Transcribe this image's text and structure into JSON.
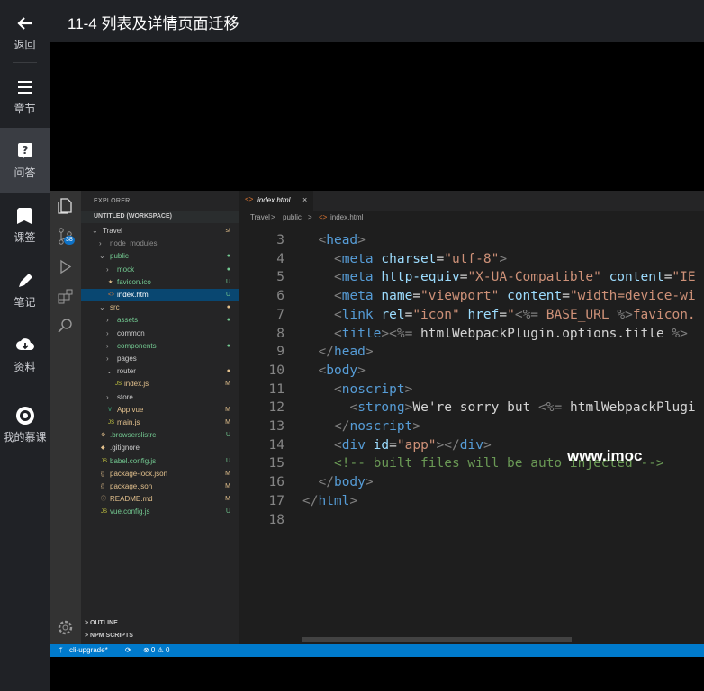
{
  "nav": {
    "back": "返回",
    "chapters": "章节",
    "qa": "问答",
    "bookmarks": "课签",
    "notes": "笔记",
    "materials": "资料",
    "my_courses": "我的慕课"
  },
  "header": {
    "title": "11-4 列表及详情页面迁移"
  },
  "vscode": {
    "activity_badge": "38",
    "explorer_title": "EXPLORER",
    "workspace": "UNTITLED (WORKSPACE)",
    "tree": [
      {
        "label": "Travel",
        "status": "st",
        "indent": 1,
        "arrow": "v",
        "icon": "",
        "color": "#cccccc",
        "status_color": "#e2c08d"
      },
      {
        "label": "node_modules",
        "status": "",
        "indent": 2,
        "arrow": ">",
        "icon": "",
        "color": "#8b8b8b",
        "status_color": ""
      },
      {
        "label": "public",
        "status": "●",
        "indent": 2,
        "arrow": "v",
        "icon": "",
        "color": "#73c991",
        "status_color": "#73c991"
      },
      {
        "label": "mock",
        "status": "●",
        "indent": 3,
        "arrow": ">",
        "icon": "",
        "color": "#73c991",
        "status_color": "#73c991"
      },
      {
        "label": "favicon.ico",
        "status": "U",
        "indent": 3,
        "arrow": "",
        "icon": "★",
        "color": "#73c991",
        "status_color": "#73c991"
      },
      {
        "label": "index.html",
        "status": "U",
        "indent": 3,
        "arrow": "",
        "icon": "<>",
        "color": "#ffffff",
        "status_color": "#73c991",
        "selected": true
      },
      {
        "label": "src",
        "status": "●",
        "indent": 2,
        "arrow": "v",
        "icon": "",
        "color": "#e2c08d",
        "status_color": "#e2c08d"
      },
      {
        "label": "assets",
        "status": "●",
        "indent": 3,
        "arrow": ">",
        "icon": "",
        "color": "#73c991",
        "status_color": "#73c991"
      },
      {
        "label": "common",
        "status": "",
        "indent": 3,
        "arrow": ">",
        "icon": "",
        "color": "#cccccc",
        "status_color": ""
      },
      {
        "label": "components",
        "status": "●",
        "indent": 3,
        "arrow": ">",
        "icon": "",
        "color": "#73c991",
        "status_color": "#73c991"
      },
      {
        "label": "pages",
        "status": "",
        "indent": 3,
        "arrow": ">",
        "icon": "",
        "color": "#cccccc",
        "status_color": ""
      },
      {
        "label": "router",
        "status": "●",
        "indent": 3,
        "arrow": "v",
        "icon": "",
        "color": "#cccccc",
        "status_color": "#e2c08d"
      },
      {
        "label": "index.js",
        "status": "M",
        "indent": 4,
        "arrow": "",
        "icon": "JS",
        "color": "#e2c08d",
        "status_color": "#e2c08d"
      },
      {
        "label": "store",
        "status": "",
        "indent": 3,
        "arrow": ">",
        "icon": "",
        "color": "#cccccc",
        "status_color": ""
      },
      {
        "label": "App.vue",
        "status": "M",
        "indent": 3,
        "arrow": "",
        "icon": "V",
        "color": "#e2c08d",
        "status_color": "#e2c08d"
      },
      {
        "label": "main.js",
        "status": "M",
        "indent": 3,
        "arrow": "",
        "icon": "JS",
        "color": "#e2c08d",
        "status_color": "#e2c08d"
      },
      {
        "label": ".browserslistrc",
        "status": "U",
        "indent": 2,
        "arrow": "",
        "icon": "⚙",
        "color": "#73c991",
        "status_color": "#73c991"
      },
      {
        "label": ".gitignore",
        "status": "",
        "indent": 2,
        "arrow": "",
        "icon": "◆",
        "color": "#cccccc",
        "status_color": ""
      },
      {
        "label": "babel.config.js",
        "status": "U",
        "indent": 2,
        "arrow": "",
        "icon": "JS",
        "color": "#73c991",
        "status_color": "#73c991"
      },
      {
        "label": "package-lock.json",
        "status": "M",
        "indent": 2,
        "arrow": "",
        "icon": "{}",
        "color": "#e2c08d",
        "status_color": "#e2c08d"
      },
      {
        "label": "package.json",
        "status": "M",
        "indent": 2,
        "arrow": "",
        "icon": "{}",
        "color": "#e2c08d",
        "status_color": "#e2c08d"
      },
      {
        "label": "README.md",
        "status": "M",
        "indent": 2,
        "arrow": "",
        "icon": "ⓘ",
        "color": "#e2c08d",
        "status_color": "#e2c08d"
      },
      {
        "label": "vue.config.js",
        "status": "U",
        "indent": 2,
        "arrow": "",
        "icon": "JS",
        "color": "#73c991",
        "status_color": "#73c991"
      }
    ],
    "outline": "OUTLINE",
    "npm_scripts": "NPM SCRIPTS",
    "tab_label": "index.html",
    "tab_close": "×",
    "breadcrumb": [
      "Travel",
      "public",
      "index.html"
    ],
    "code_lines": [
      {
        "n": "3",
        "indent": 1,
        "tokens": [
          [
            "b",
            "<"
          ],
          [
            "tag",
            "head"
          ],
          [
            "b",
            ">"
          ]
        ]
      },
      {
        "n": "4",
        "indent": 2,
        "tokens": [
          [
            "b",
            "<"
          ],
          [
            "tag",
            "meta"
          ],
          [
            "tx",
            " "
          ],
          [
            "attr",
            "charset"
          ],
          [
            "tx",
            "="
          ],
          [
            "str",
            "\"utf-8\""
          ],
          [
            "b",
            ">"
          ]
        ]
      },
      {
        "n": "5",
        "indent": 2,
        "tokens": [
          [
            "b",
            "<"
          ],
          [
            "tag",
            "meta"
          ],
          [
            "tx",
            " "
          ],
          [
            "attr",
            "http-equiv"
          ],
          [
            "tx",
            "="
          ],
          [
            "str",
            "\"X-UA-Compatible\""
          ],
          [
            "tx",
            " "
          ],
          [
            "attr",
            "content"
          ],
          [
            "tx",
            "="
          ],
          [
            "str",
            "\"IE"
          ]
        ]
      },
      {
        "n": "6",
        "indent": 2,
        "tokens": [
          [
            "b",
            "<"
          ],
          [
            "tag",
            "meta"
          ],
          [
            "tx",
            " "
          ],
          [
            "attr",
            "name"
          ],
          [
            "tx",
            "="
          ],
          [
            "str",
            "\"viewport\""
          ],
          [
            "tx",
            " "
          ],
          [
            "attr",
            "content"
          ],
          [
            "tx",
            "="
          ],
          [
            "str",
            "\"width=device-wi"
          ]
        ]
      },
      {
        "n": "7",
        "indent": 2,
        "tokens": [
          [
            "b",
            "<"
          ],
          [
            "tag",
            "link"
          ],
          [
            "tx",
            " "
          ],
          [
            "attr",
            "rel"
          ],
          [
            "tx",
            "="
          ],
          [
            "str",
            "\"icon\""
          ],
          [
            "tx",
            " "
          ],
          [
            "attr",
            "href"
          ],
          [
            "tx",
            "="
          ],
          [
            "str",
            "\""
          ],
          [
            "b",
            "<%="
          ],
          [
            "str",
            " BASE_URL "
          ],
          [
            "b",
            "%>"
          ],
          [
            "str",
            "favicon."
          ]
        ]
      },
      {
        "n": "8",
        "indent": 2,
        "tokens": [
          [
            "b",
            "<"
          ],
          [
            "tag",
            "title"
          ],
          [
            "b",
            ">"
          ],
          [
            "b",
            "<%="
          ],
          [
            "tx",
            " htmlWebpackPlugin.options.title "
          ],
          [
            "b",
            "%>"
          ]
        ]
      },
      {
        "n": "9",
        "indent": 1,
        "tokens": [
          [
            "b",
            "</"
          ],
          [
            "tag",
            "head"
          ],
          [
            "b",
            ">"
          ]
        ]
      },
      {
        "n": "10",
        "indent": 1,
        "tokens": [
          [
            "b",
            "<"
          ],
          [
            "tag",
            "body"
          ],
          [
            "b",
            ">"
          ]
        ]
      },
      {
        "n": "11",
        "indent": 2,
        "tokens": [
          [
            "b",
            "<"
          ],
          [
            "tag",
            "noscript"
          ],
          [
            "b",
            ">"
          ]
        ]
      },
      {
        "n": "12",
        "indent": 3,
        "tokens": [
          [
            "b",
            "<"
          ],
          [
            "tag",
            "strong"
          ],
          [
            "b",
            ">"
          ],
          [
            "tx",
            "We're sorry but "
          ],
          [
            "b",
            "<%="
          ],
          [
            "tx",
            " htmlWebpackPlugi"
          ]
        ]
      },
      {
        "n": "13",
        "indent": 2,
        "tokens": [
          [
            "b",
            "</"
          ],
          [
            "tag",
            "noscript"
          ],
          [
            "b",
            ">"
          ]
        ]
      },
      {
        "n": "14",
        "indent": 2,
        "tokens": [
          [
            "b",
            "<"
          ],
          [
            "tag",
            "div"
          ],
          [
            "tx",
            " "
          ],
          [
            "attr",
            "id"
          ],
          [
            "tx",
            "="
          ],
          [
            "str",
            "\"app\""
          ],
          [
            "b",
            "></"
          ],
          [
            "tag",
            "div"
          ],
          [
            "b",
            ">"
          ]
        ]
      },
      {
        "n": "15",
        "indent": 2,
        "tokens": [
          [
            "com",
            "<!-- built files will be auto injected -->"
          ]
        ]
      },
      {
        "n": "16",
        "indent": 1,
        "tokens": [
          [
            "b",
            "</"
          ],
          [
            "tag",
            "body"
          ],
          [
            "b",
            ">"
          ]
        ]
      },
      {
        "n": "17",
        "indent": 0,
        "tokens": [
          [
            "b",
            "</"
          ],
          [
            "tag",
            "html"
          ],
          [
            "b",
            ">"
          ]
        ]
      },
      {
        "n": "18",
        "indent": 0,
        "tokens": []
      }
    ],
    "status_branch": "cli-upgrade*",
    "status_errors": "⊗ 0 ⚠ 0"
  },
  "watermark": "www.imoc"
}
